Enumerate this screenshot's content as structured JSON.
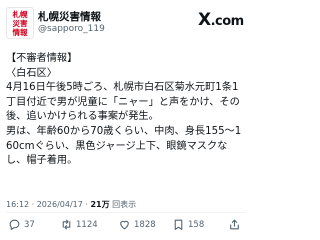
{
  "account": {
    "avatar_lines": [
      "札幌",
      "災害",
      "情報"
    ],
    "name": "札幌災害情報",
    "handle": "@sapporo_119"
  },
  "brand": {
    "x": "X",
    "com": ".com"
  },
  "tweet": {
    "text": "【不審者情報】\n〈白石区〉\n4月16日午後5時ごろ、札幌市白石区菊水元町1条1丁目付近で男が児童に「ニャー」と声をかけ、その後、追いかけられる事案が発生。\n男は、年齢60から70歳くらい、中肉、身長155〜160cmぐらい、黒色ジャージ上下、眼鏡マスクなし、帽子着用。",
    "time": "16:12",
    "date": "2026/04/17",
    "views": "21万",
    "views_label": "回表示"
  },
  "actions": {
    "reply": "37",
    "retweet": "1124",
    "like": "1828",
    "bookmark": "158"
  }
}
